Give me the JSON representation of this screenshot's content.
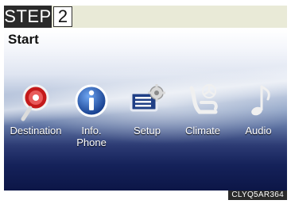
{
  "step": {
    "label": "STEP",
    "number": "2"
  },
  "screen": {
    "title": "Start",
    "menu": [
      {
        "label": "Destination",
        "icon": "destination-pin-icon"
      },
      {
        "label": "Info.\nPhone",
        "icon": "info-icon"
      },
      {
        "label": "Setup",
        "icon": "setup-gear-icon"
      },
      {
        "label": "Climate",
        "icon": "climate-seat-fan-icon"
      },
      {
        "label": "Audio",
        "icon": "music-note-icon"
      }
    ]
  },
  "footer": {
    "code": "CLYQ5AR364"
  }
}
